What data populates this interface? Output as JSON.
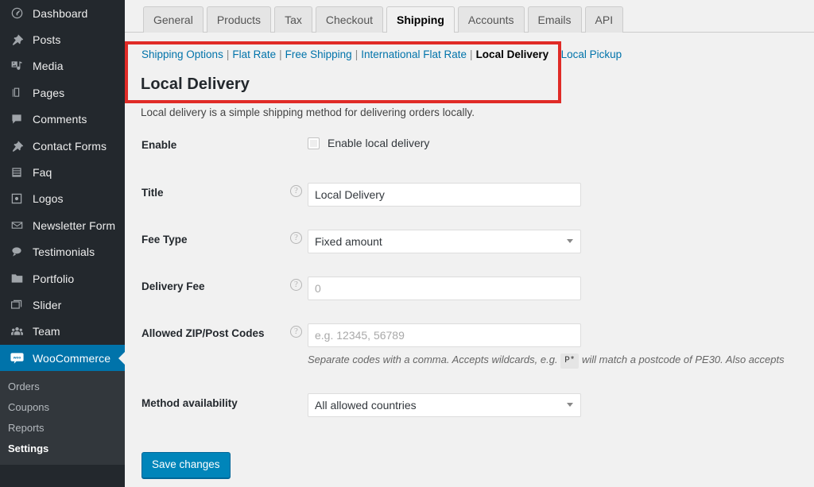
{
  "sidebar": {
    "items": [
      {
        "label": "Dashboard",
        "icon": "dashboard-icon"
      },
      {
        "label": "Posts",
        "icon": "pin-icon"
      },
      {
        "label": "Media",
        "icon": "media-icon"
      },
      {
        "label": "Pages",
        "icon": "pages-icon"
      },
      {
        "label": "Comments",
        "icon": "comment-icon"
      },
      {
        "label": "Contact Forms",
        "icon": "pin-icon"
      },
      {
        "label": "Faq",
        "icon": "list-icon"
      },
      {
        "label": "Logos",
        "icon": "image-icon"
      },
      {
        "label": "Newsletter Form",
        "icon": "envelope-icon"
      },
      {
        "label": "Testimonials",
        "icon": "speech-bubble-icon"
      },
      {
        "label": "Portfolio",
        "icon": "folder-icon"
      },
      {
        "label": "Slider",
        "icon": "slides-icon"
      },
      {
        "label": "Team",
        "icon": "people-icon"
      },
      {
        "label": "WooCommerce",
        "icon": "woocommerce-icon",
        "current": true
      }
    ],
    "submenu": [
      {
        "label": "Orders"
      },
      {
        "label": "Coupons"
      },
      {
        "label": "Reports"
      },
      {
        "label": "Settings",
        "current": true
      }
    ],
    "active_color": "#0073aa"
  },
  "tabs": [
    {
      "label": "General"
    },
    {
      "label": "Products"
    },
    {
      "label": "Tax"
    },
    {
      "label": "Checkout"
    },
    {
      "label": "Shipping",
      "active": true
    },
    {
      "label": "Accounts"
    },
    {
      "label": "Emails"
    },
    {
      "label": "API"
    }
  ],
  "subnav": {
    "items": [
      {
        "label": "Shipping Options"
      },
      {
        "label": "Flat Rate"
      },
      {
        "label": "Free Shipping"
      },
      {
        "label": "International Flat Rate"
      },
      {
        "label": "Local Delivery",
        "current": true
      },
      {
        "label": "Local Pickup"
      }
    ],
    "separator": "|"
  },
  "highlight": {
    "color": "#e02b27"
  },
  "page": {
    "title": "Local Delivery",
    "intro": "Local delivery is a simple shipping method for delivering orders locally."
  },
  "form": {
    "enable": {
      "label": "Enable",
      "checkbox_label": "Enable local delivery",
      "checked": false
    },
    "title": {
      "label": "Title",
      "value": "Local Delivery",
      "help": "?"
    },
    "fee_type": {
      "label": "Fee Type",
      "value": "Fixed amount",
      "help": "?"
    },
    "delivery_fee": {
      "label": "Delivery Fee",
      "placeholder": "0",
      "value": "",
      "help": "?"
    },
    "zip_codes": {
      "label": "Allowed ZIP/Post Codes",
      "placeholder": "e.g. 12345, 56789",
      "value": "",
      "help": "?",
      "hint_before": "Separate codes with a comma. Accepts wildcards, e.g.",
      "hint_code": "P*",
      "hint_after": "will match a postcode of PE30. Also accepts"
    },
    "method_availability": {
      "label": "Method availability",
      "value": "All allowed countries"
    },
    "save_label": "Save changes",
    "save_color": "#0085ba"
  }
}
